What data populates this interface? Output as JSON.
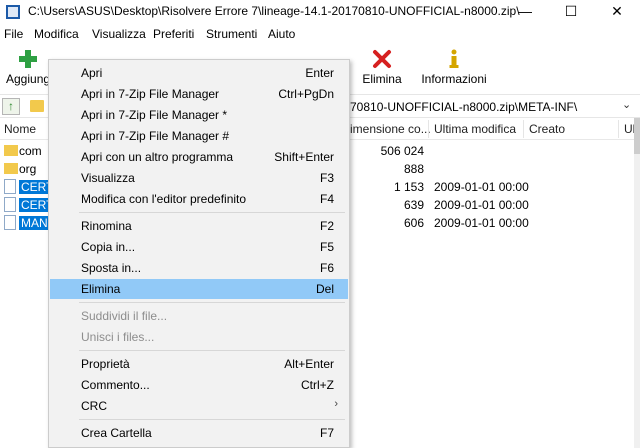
{
  "window": {
    "title": "C:\\Users\\ASUS\\Desktop\\Risolvere Errore 7\\lineage-14.1-20170810-UNOFFICIAL-n8000.zip\\META-INF\\",
    "minimize": "—",
    "maximize": "☐",
    "close": "✕"
  },
  "menubar": [
    "File",
    "Modifica",
    "Visualizza",
    "Preferiti",
    "Strumenti",
    "Aiuto"
  ],
  "toolbar": {
    "add": "Aggiungi",
    "delete": "Elimina",
    "info": "Informazioni"
  },
  "address": {
    "path": "70810-UNOFFICIAL-n8000.zip\\META-INF\\",
    "up_icon": "↑",
    "dropdown": "⌄"
  },
  "columns": {
    "name": "Nome",
    "size": "imensione co...",
    "modified": "Ultima modifica",
    "created": "Creato",
    "last": "Ult"
  },
  "files": [
    {
      "name": "com",
      "type": "folder",
      "size": "506 024",
      "modified": "",
      "selected": false
    },
    {
      "name": "org",
      "type": "folder",
      "size": "888",
      "modified": "",
      "selected": false
    },
    {
      "name": "CERT",
      "type": "file",
      "size": "1 153",
      "modified": "2009-01-01 00:00",
      "selected": true
    },
    {
      "name": "CERT",
      "type": "file",
      "size": "639",
      "modified": "2009-01-01 00:00",
      "selected": true
    },
    {
      "name": "MAN",
      "type": "file",
      "size": "606",
      "modified": "2009-01-01 00:00",
      "selected": true
    }
  ],
  "context_menu": {
    "open": {
      "label": "Apri",
      "shortcut": "Enter"
    },
    "open_inside": {
      "label": "Apri in 7-Zip File Manager",
      "shortcut": "Ctrl+PgDn"
    },
    "open_inside_star": {
      "label": "Apri in 7-Zip File Manager *",
      "shortcut": ""
    },
    "open_inside_hash": {
      "label": "Apri in 7-Zip File Manager #",
      "shortcut": ""
    },
    "open_with": {
      "label": "Apri con un altro programma",
      "shortcut": "Shift+Enter"
    },
    "view": {
      "label": "Visualizza",
      "shortcut": "F3"
    },
    "edit": {
      "label": "Modifica con l'editor predefinito",
      "shortcut": "F4"
    },
    "rename": {
      "label": "Rinomina",
      "shortcut": "F2"
    },
    "copy_to": {
      "label": "Copia in...",
      "shortcut": "F5"
    },
    "move_to": {
      "label": "Sposta in...",
      "shortcut": "F6"
    },
    "delete": {
      "label": "Elimina",
      "shortcut": "Del"
    },
    "split": {
      "label": "Suddividi il file...",
      "shortcut": ""
    },
    "combine": {
      "label": "Unisci i files...",
      "shortcut": ""
    },
    "properties": {
      "label": "Proprietà",
      "shortcut": "Alt+Enter"
    },
    "comment": {
      "label": "Commento...",
      "shortcut": "Ctrl+Z"
    },
    "crc": {
      "label": "CRC",
      "shortcut": "›"
    },
    "create_folder": {
      "label": "Crea Cartella",
      "shortcut": "F7"
    }
  }
}
